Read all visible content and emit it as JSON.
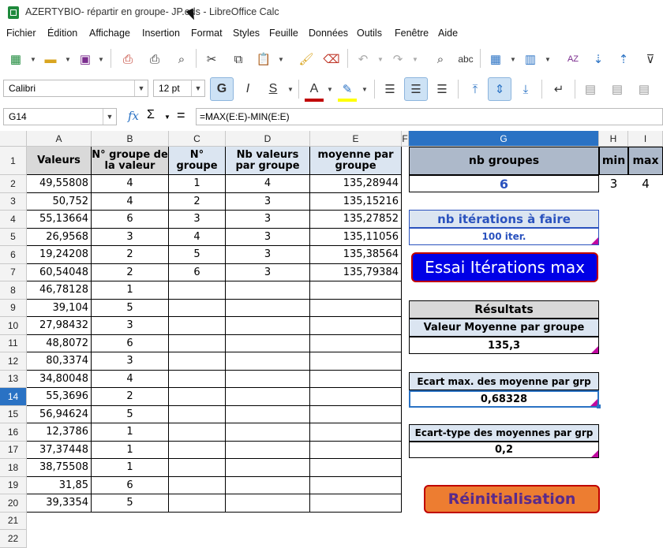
{
  "window": {
    "title": "AZERTYBIO- répartir en groupe- JP.ods - LibreOffice Calc"
  },
  "menu": [
    "Fichier",
    "Édition",
    "Affichage",
    "Insertion",
    "Format",
    "Styles",
    "Feuille",
    "Données",
    "Outils",
    "Fenêtre",
    "Aide"
  ],
  "formatting": {
    "font_name": "Calibri",
    "font_size": "12 pt"
  },
  "formula_bar": {
    "name_box": "G14",
    "formula": "=MAX(E:E)-MIN(E:E)",
    "fx": "fx",
    "sum": "Σ",
    "equals": "="
  },
  "columns": [
    "A",
    "B",
    "C",
    "D",
    "E",
    "F",
    "G",
    "H",
    "I"
  ],
  "selected_cell": {
    "column": "G",
    "row": "14"
  },
  "rows": [
    "1",
    "2",
    "3",
    "4",
    "5",
    "6",
    "7",
    "8",
    "9",
    "10",
    "11",
    "12",
    "13",
    "14",
    "15",
    "16",
    "17",
    "18",
    "19",
    "20",
    "21",
    "22"
  ],
  "table": {
    "headers": [
      "Valeurs",
      "N° groupe de la valeur",
      "N° groupe",
      "Nb valeurs par groupe",
      "moyenne par groupe"
    ],
    "col_a": [
      "49,55808",
      "50,752",
      "55,13664",
      "26,9568",
      "19,24208",
      "60,54048",
      "46,78128",
      "39,104",
      "27,98432",
      "48,8072",
      "80,3374",
      "34,80048",
      "55,3696",
      "56,94624",
      "12,3786",
      "37,37448",
      "38,75508",
      "31,85",
      "39,3354"
    ],
    "col_b": [
      "4",
      "4",
      "6",
      "3",
      "2",
      "2",
      "1",
      "5",
      "3",
      "6",
      "3",
      "4",
      "2",
      "5",
      "1",
      "1",
      "1",
      "6",
      "5"
    ],
    "col_c": [
      "1",
      "2",
      "3",
      "4",
      "5",
      "6"
    ],
    "col_d": [
      "4",
      "3",
      "3",
      "3",
      "3",
      "3"
    ],
    "col_e": [
      "135,28944",
      "135,15216",
      "135,27852",
      "135,11056",
      "135,38564",
      "135,79384"
    ]
  },
  "panel": {
    "nb_groupes_label": "nb groupes",
    "nb_groupes_value": "6",
    "min_label": "min",
    "max_label": "max",
    "min_value": "3",
    "max_value": "4",
    "iterations_label": "nb itérations à faire",
    "iterations_value": "100 iter.",
    "essai_button": "Essai Itérations max",
    "resultats_label": "Résultats",
    "valeur_moyenne_label": "Valeur Moyenne par groupe",
    "valeur_moyenne_value": "135,3",
    "ecart_max_label": "Ecart max. des moyenne par grp",
    "ecart_max_value": "0,68328",
    "ecart_type_label": "Ecart-type des moyennes par grp",
    "ecart_type_value": "0,2",
    "reinit_button": "Réinitialisation"
  },
  "colors": {
    "selection": "#2a72c4",
    "blue_button": "#0000e6",
    "orange_button": "#ed7d31",
    "header_blue": "#dbe5f1",
    "comment_marker": "#c00aa0"
  }
}
